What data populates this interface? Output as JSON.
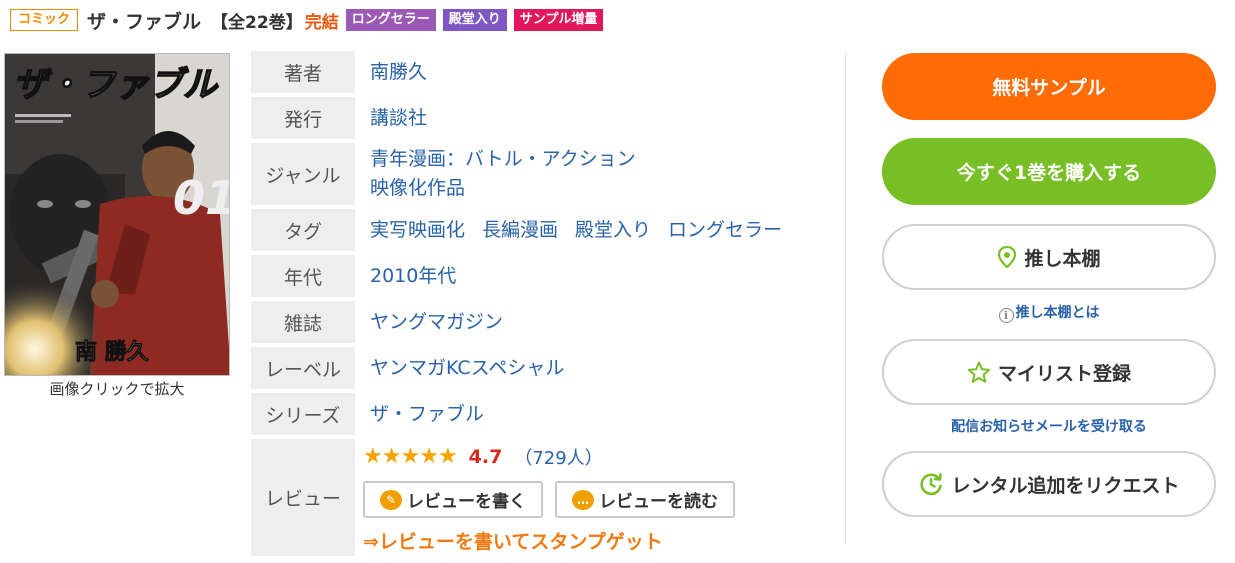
{
  "header": {
    "category": "コミック",
    "title": "ザ・ファブル",
    "volumes": "【全22巻】",
    "status": "完結",
    "badges": [
      {
        "label": "ロングセラー",
        "color": "#9b59b6"
      },
      {
        "label": "殿堂入り",
        "color": "#7e57c2"
      },
      {
        "label": "サンプル増量",
        "color": "#e2185b"
      }
    ]
  },
  "cover": {
    "title_art": "ザ・ファブル",
    "volume_number": "01",
    "author_art": "南 勝久",
    "caption": "画像クリックで拡大"
  },
  "info": {
    "author": {
      "label": "著者",
      "value": "南勝久"
    },
    "publisher": {
      "label": "発行",
      "value": "講談社"
    },
    "genre": {
      "label": "ジャンル",
      "values": [
        "青年漫画：バトル・アクション",
        "映像化作品"
      ]
    },
    "tags": {
      "label": "タグ",
      "values": [
        "実写映画化",
        "長編漫画",
        "殿堂入り",
        "ロングセラー"
      ]
    },
    "era": {
      "label": "年代",
      "value": "2010年代"
    },
    "magazine": {
      "label": "雑誌",
      "value": "ヤングマガジン"
    },
    "label_imprint": {
      "label": "レーベル",
      "value": "ヤンマガKCスペシャル"
    },
    "series": {
      "label": "シリーズ",
      "value": "ザ・ファブル"
    },
    "review": {
      "label": "レビュー",
      "stars": 4.7,
      "rating": "4.7",
      "count": "（729人）",
      "write_button": "レビューを書く",
      "read_button": "レビューを読む",
      "stamp_link": "⇒レビューを書いてスタンプゲット"
    }
  },
  "actions": {
    "free_sample": "無料サンプル",
    "buy_now": "今すぐ1巻を購入する",
    "oshi_shelf": "推し本棚",
    "oshi_help": "推し本棚とは",
    "my_list": "マイリスト登録",
    "notify_link": "配信お知らせメールを受け取る",
    "rental_request": "レンタル追加をリクエスト"
  },
  "colors": {
    "accent_orange": "#ff6b05",
    "accent_green": "#78bf26",
    "link_blue": "#2962a8",
    "star_gold": "#f7a400",
    "rating_red": "#d62a1e"
  }
}
